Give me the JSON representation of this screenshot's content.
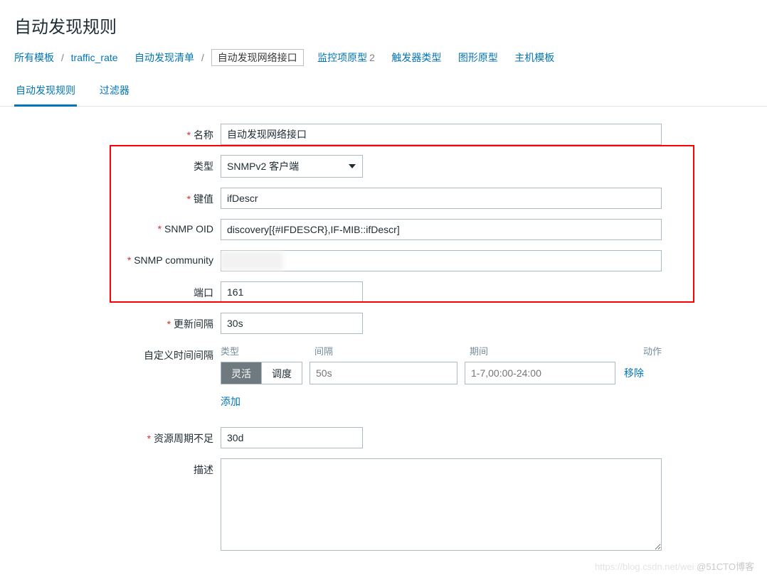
{
  "page_title": "自动发现规则",
  "breadcrumb": {
    "all_templates": "所有模板",
    "template_name": "traffic_rate",
    "discovery_list": "自动发现清单",
    "current": "自动发现网络接口",
    "item_prototypes": "监控项原型",
    "item_prototypes_count": "2",
    "trigger_prototypes": "触发器类型",
    "graph_prototypes": "图形原型",
    "host_prototypes": "主机模板"
  },
  "tabs": {
    "rule": "自动发现规则",
    "filters": "过滤器"
  },
  "labels": {
    "name": "名称",
    "type": "类型",
    "key": "键值",
    "snmp_oid": "SNMP OID",
    "snmp_community": "SNMP community",
    "port": "端口",
    "update_interval": "更新间隔",
    "custom_intervals": "自定义时间间隔",
    "keep_lost": "资源周期不足",
    "description": "描述"
  },
  "values": {
    "name": "自动发现网络接口",
    "type": "SNMPv2 客户端",
    "key": "ifDescr",
    "snmp_oid": "discovery[{#IFDESCR},IF-MIB::ifDescr]",
    "snmp_community": "",
    "port": "161",
    "update_interval": "30s",
    "keep_lost": "30d",
    "description": ""
  },
  "interval_table": {
    "head_type": "类型",
    "head_delay": "间隔",
    "head_period": "期间",
    "head_action": "动作",
    "seg_flexible": "灵活",
    "seg_scheduling": "调度",
    "delay_placeholder": "50s",
    "period_placeholder": "1-7,00:00-24:00",
    "remove": "移除",
    "add": "添加"
  },
  "watermark": {
    "faint": "https://blog.csdn.net/wei",
    "main": "@51CTO博客"
  }
}
